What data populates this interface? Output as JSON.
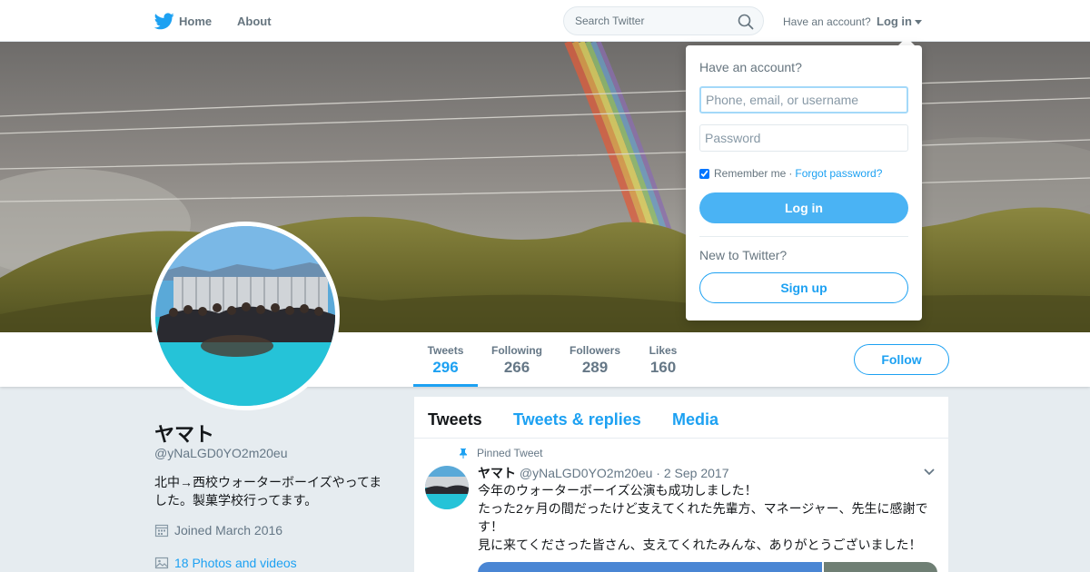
{
  "nav": {
    "home_label": "Home",
    "about_label": "About",
    "search_placeholder": "Search Twitter",
    "have_account": "Have an account?",
    "login_label": "Log in",
    "icons": {
      "logo": "twitter-bird-icon",
      "search": "search-icon",
      "caret": "caret-down-icon"
    }
  },
  "profile": {
    "name": "ヤマト",
    "handle": "@yNaLGD0YO2m20eu",
    "bio": "北中→西校ウォーターボーイズやってました。製菓学校行ってます。",
    "joined": "Joined March 2016",
    "photos": "18 Photos and videos"
  },
  "stats": [
    {
      "label": "Tweets",
      "value": "296",
      "active": true
    },
    {
      "label": "Following",
      "value": "266",
      "active": false
    },
    {
      "label": "Followers",
      "value": "289",
      "active": false
    },
    {
      "label": "Likes",
      "value": "160",
      "active": false
    }
  ],
  "follow_label": "Follow",
  "tabs": [
    {
      "label": "Tweets",
      "active": true
    },
    {
      "label": "Tweets & replies",
      "active": false
    },
    {
      "label": "Media",
      "active": false
    }
  ],
  "tweet": {
    "pinned_label": "Pinned Tweet",
    "name": "ヤマト",
    "handle": "@yNaLGD0YO2m20eu",
    "separator": "·",
    "date": "2 Sep 2017",
    "lines": [
      "今年のウォーターボーイズ公演も成功しました！",
      "たった2ヶ月の間だったけど支えてくれた先輩方、マネージャー、先生に感謝です！",
      "見に来てくださった皆さん、支えてくれたみんな、ありがとうございました！"
    ]
  },
  "login_dropdown": {
    "title": "Have an account?",
    "username_placeholder": "Phone, email, or username",
    "password_placeholder": "Password",
    "remember_label": "Remember me",
    "separator": "·",
    "forgot_label": "Forgot password?",
    "login_button": "Log in",
    "new_label": "New to Twitter?",
    "signup_button": "Sign up"
  },
  "colors": {
    "accent": "#1da1f2",
    "button_fill": "#4ab3f4",
    "background": "#e6ecf0",
    "muted_text": "#657786"
  }
}
